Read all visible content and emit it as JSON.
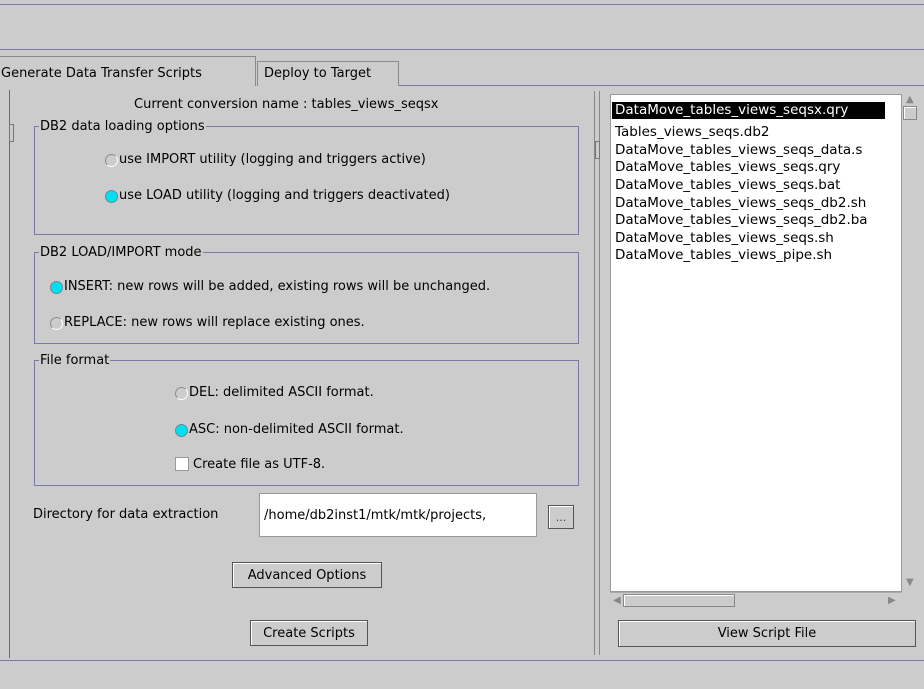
{
  "tabs": [
    {
      "label": "Generate Data Transfer Scripts",
      "selected": true
    },
    {
      "label": "Deploy to Target",
      "selected": false
    }
  ],
  "conversion_name": "Current conversion name : tables_views_seqsx",
  "loading_options": {
    "legend": "DB2 data loading options",
    "options": [
      {
        "label": "use IMPORT utility (logging and triggers active)",
        "selected": false
      },
      {
        "label": "use LOAD utility  (logging and triggers deactivated)",
        "selected": true
      }
    ]
  },
  "mode": {
    "legend": "DB2 LOAD/IMPORT mode",
    "options": [
      {
        "label": "INSERT: new rows will be added, existing rows will be unchanged.",
        "selected": true
      },
      {
        "label": "REPLACE: new rows will replace existing ones.",
        "selected": false
      }
    ]
  },
  "file_format": {
    "legend": "File format",
    "options": [
      {
        "label": "DEL: delimited ASCII format.",
        "selected": false
      },
      {
        "label": "ASC: non-delimited ASCII format.",
        "selected": true
      }
    ],
    "utf8_label": "Create file as UTF-8.",
    "utf8_checked": false
  },
  "directory": {
    "label": "Directory for data extraction",
    "value": "/home/db2inst1/mtk/mtk/projects,",
    "browse_label": "..."
  },
  "buttons": {
    "advanced": "Advanced Options",
    "create": "Create Scripts",
    "view": "View Script File"
  },
  "script_files": [
    "DataMove_tables_views_seqsx.qry",
    "Tables_views_seqs.db2",
    "DataMove_tables_views_seqs_data.s",
    "DataMove_tables_views_seqs.qry",
    "DataMove_tables_views_seqs.bat",
    "DataMove_tables_views_seqs_db2.sh",
    "DataMove_tables_views_seqs_db2.ba",
    "DataMove_tables_views_seqs.sh",
    "DataMove_tables_views_pipe.sh"
  ],
  "selected_file_index": 0,
  "colors": {
    "radio_selected": "#00e0ee",
    "background": "#cccccc",
    "rule": "#7a7aa8"
  }
}
